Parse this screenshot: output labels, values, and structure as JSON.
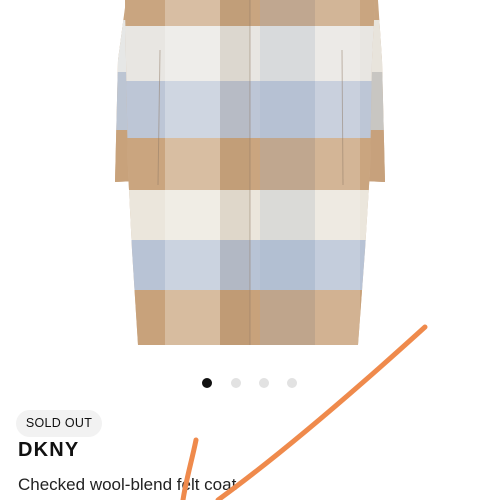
{
  "product": {
    "status_badge": "SOLD OUT",
    "brand": "DKNY",
    "name": "Checked wool-blend felt coat",
    "image_alt": "Checked wool-blend felt coat"
  },
  "carousel": {
    "total_images": 4,
    "active_index": 0,
    "active_color": "#111111",
    "inactive_color": "#e2e2e2"
  },
  "colors": {
    "coat_camel": "#c9a580",
    "coat_blue": "#b9c5d6",
    "coat_cream": "#eeeae1",
    "annotation_stroke": "#ef8a4c"
  }
}
